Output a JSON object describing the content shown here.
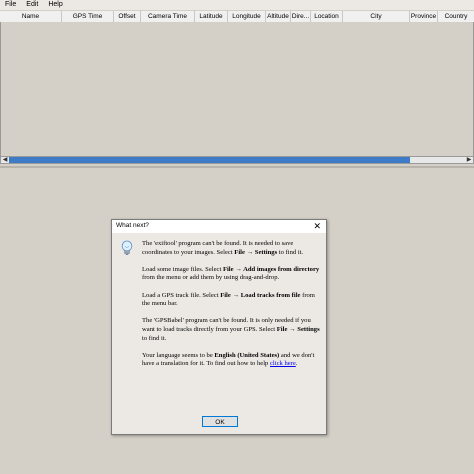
{
  "menu": [
    "File",
    "Edit",
    "Help"
  ],
  "table": {
    "columns": [
      "Name",
      "GPS Time",
      "Offset",
      "Camera Time",
      "Latitude",
      "Longitude",
      "Altitude",
      "Dire...",
      "Location",
      "City",
      "Province",
      "Country"
    ]
  },
  "dialog": {
    "title": "What next?",
    "close_glyph": "✕",
    "p1_a": "The 'exiftool' program can't be found. It is needed to save coordinates to your images. Select ",
    "p1_b": "File → Settings",
    "p1_c": " to find it.",
    "p2_a": "Load some image files. Select ",
    "p2_b": "File → Add images from directory",
    "p2_c": " from the menu or add them by using drag-and-drop.",
    "p3_a": "Load a GPS track file. Select ",
    "p3_b": "File → Load tracks from file",
    "p3_c": " from the menu bar.",
    "p4_a": "The 'GPSBabel' program can't be found. It is only needed if you want to load tracks directly from your GPS. Select ",
    "p4_b": "File → Settings",
    "p4_c": " to find it.",
    "p5_a": "Your language seems to be ",
    "p5_b": "English (United States)",
    "p5_c": " and we don't have a translation for it. To find out how to help ",
    "p5_link": "click here",
    "p5_d": ".",
    "ok_label": "OK"
  },
  "scrollbar": {
    "left_glyph": "◀",
    "right_glyph": "▶",
    "thumb_fraction": 0.88
  }
}
